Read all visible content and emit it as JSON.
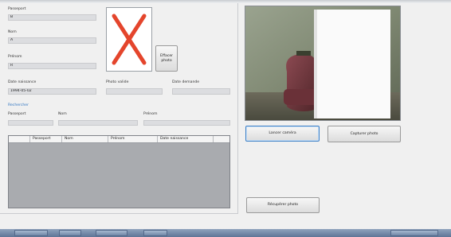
{
  "form": {
    "passport_label": "Passeport",
    "passport_value": "B",
    "name_label": "Nom",
    "name_value": "A",
    "firstname_label": "Prénom",
    "firstname_value": "R",
    "birthdate_label": "Date naissance",
    "birthdate_value": "1994-05-02",
    "photo_path_label": "Photo valide",
    "photo_path_value": "",
    "request_date_label": "Date demande",
    "request_date_value": "",
    "clear_photo_button": "Effacer photo"
  },
  "search": {
    "link": "Rechercher",
    "passport_label": "Passeport",
    "name_label": "Nom",
    "firstname_label": "Prénom"
  },
  "grid": {
    "columns": [
      "Passeport",
      "Nom",
      "Prénom",
      "Date naissance"
    ]
  },
  "camera": {
    "start_button": "Lancer caméra",
    "capture_button": "Capturer photo",
    "recover_button": "Récupérer photo"
  },
  "colors": {
    "no_photo_cross": "#e4452c",
    "link": "#2f74c0"
  },
  "icons": {
    "photo_placeholder": "cross-icon"
  }
}
